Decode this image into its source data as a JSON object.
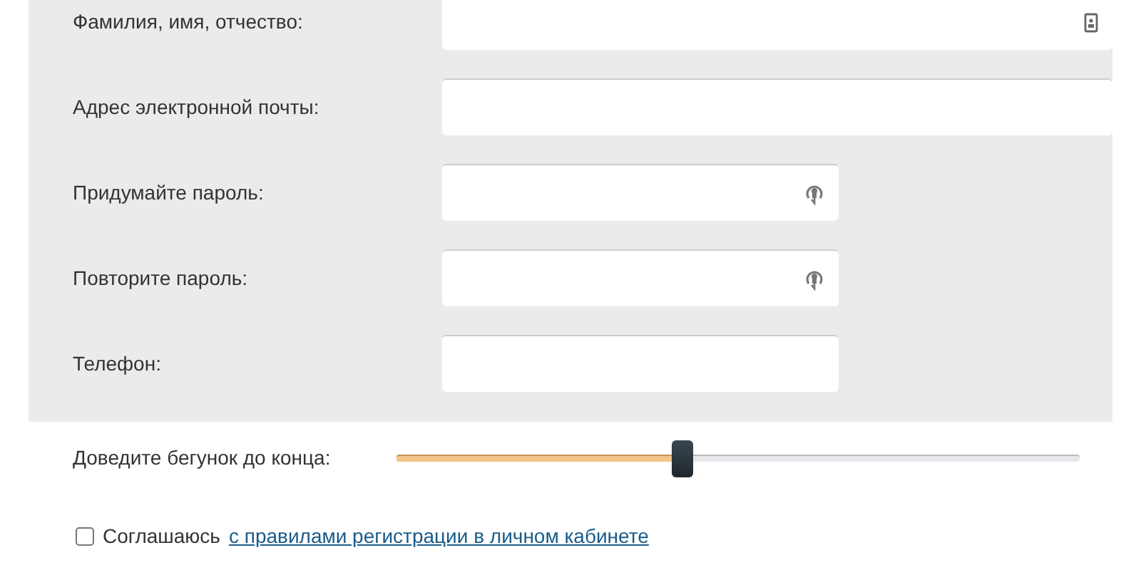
{
  "fields": [
    {
      "label": "Фамилия, имя, отчество:",
      "kind": "name"
    },
    {
      "label": "Адрес электронной почты:",
      "kind": "email"
    },
    {
      "label": "Придумайте пароль:",
      "kind": "password"
    },
    {
      "label": "Повторите пароль:",
      "kind": "password"
    },
    {
      "label": "Телефон:",
      "kind": "phone"
    }
  ],
  "slider": {
    "label": "Доведите бегунок до конца:",
    "level": 0.42
  },
  "agreement": {
    "checked": false,
    "text": "Соглашаюсь",
    "link": "с правилами регистрации в личном кабинете"
  }
}
